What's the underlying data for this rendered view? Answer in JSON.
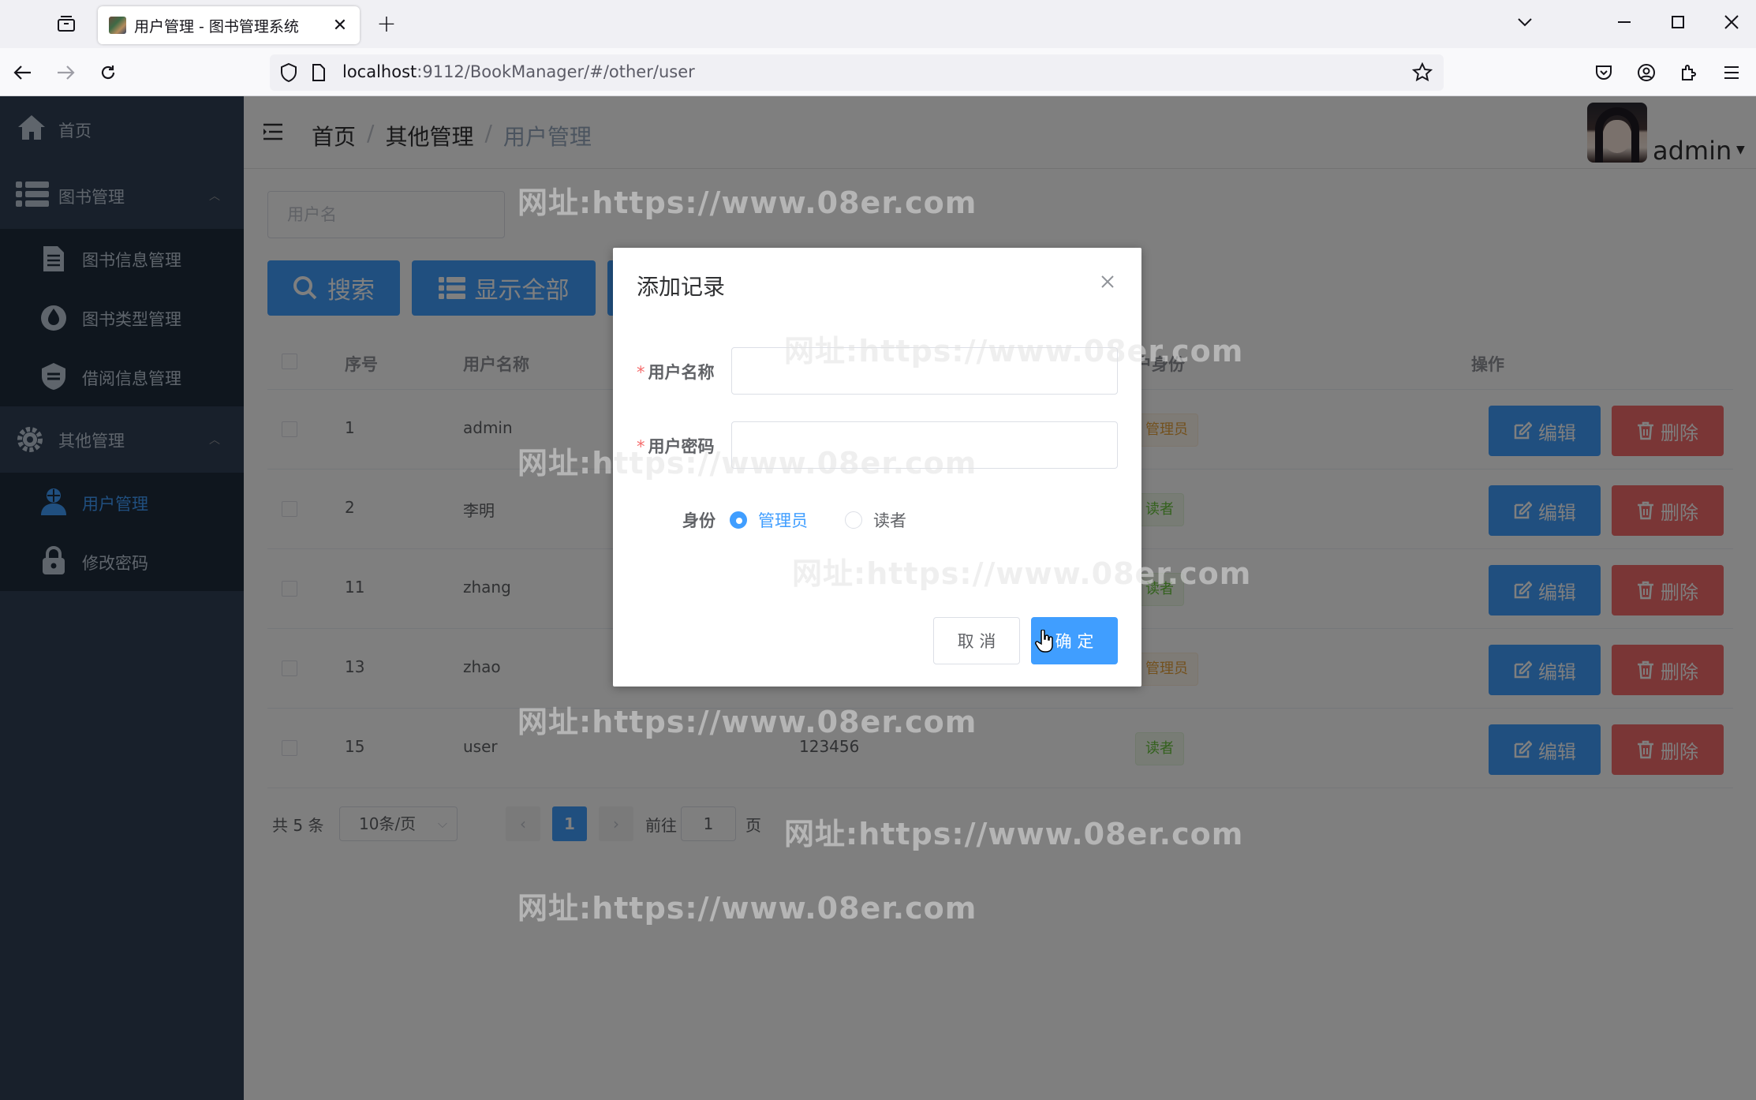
{
  "browser": {
    "tab_title": "用户管理 - 图书管理系统",
    "url_host": "localhost",
    "url_rest": ":9112/BookManager/#/other/user"
  },
  "sidebar": {
    "items": [
      {
        "label": "首页",
        "icon": "home-icon"
      },
      {
        "label": "图书管理",
        "icon": "list-icon"
      },
      {
        "label": "图书信息管理",
        "icon": "document-icon"
      },
      {
        "label": "图书类型管理",
        "icon": "drop-icon"
      },
      {
        "label": "借阅信息管理",
        "icon": "badge-icon"
      },
      {
        "label": "其他管理",
        "icon": "gear-icon"
      },
      {
        "label": "用户管理",
        "icon": "user-icon"
      },
      {
        "label": "修改密码",
        "icon": "lock-icon"
      }
    ]
  },
  "header": {
    "breadcrumb": [
      "首页",
      "其他管理",
      "用户管理"
    ],
    "username": "admin"
  },
  "toolbar": {
    "search_placeholder": "用户名",
    "search_label": "搜索",
    "show_all_label": "显示全部"
  },
  "table": {
    "columns": [
      "序号",
      "用户名称",
      "",
      "户身份",
      "操作"
    ],
    "rows": [
      {
        "id": "1",
        "name": "admin",
        "password": "",
        "role": "管理员",
        "role_type": "warning"
      },
      {
        "id": "2",
        "name": "李明",
        "password": "",
        "role": "读者",
        "role_type": "success"
      },
      {
        "id": "11",
        "name": "zhang",
        "password": "",
        "role": "读者",
        "role_type": "success"
      },
      {
        "id": "13",
        "name": "zhao",
        "password": "",
        "role": "管理员",
        "role_type": "warning"
      },
      {
        "id": "15",
        "name": "user",
        "password": "123456",
        "role": "读者",
        "role_type": "success"
      }
    ],
    "edit_label": "编辑",
    "delete_label": "删除"
  },
  "pager": {
    "total": "共 5 条",
    "page_size": "10条/页",
    "current_page": "1",
    "goto_prefix": "前往",
    "goto_value": "1",
    "goto_suffix": "页"
  },
  "dialog": {
    "title": "添加记录",
    "username_label": "用户名称",
    "password_label": "用户密码",
    "role_label": "身份",
    "role_options": [
      "管理员",
      "读者"
    ],
    "selected_role": "管理员",
    "cancel_label": "取 消",
    "ok_label": "确 定"
  },
  "watermark": "网址:https://www.08er.com",
  "colors": {
    "primary": "#409eff",
    "danger": "#f56c6c",
    "sidebar_bg": "#304156",
    "sidebar_active": "#409eff"
  }
}
